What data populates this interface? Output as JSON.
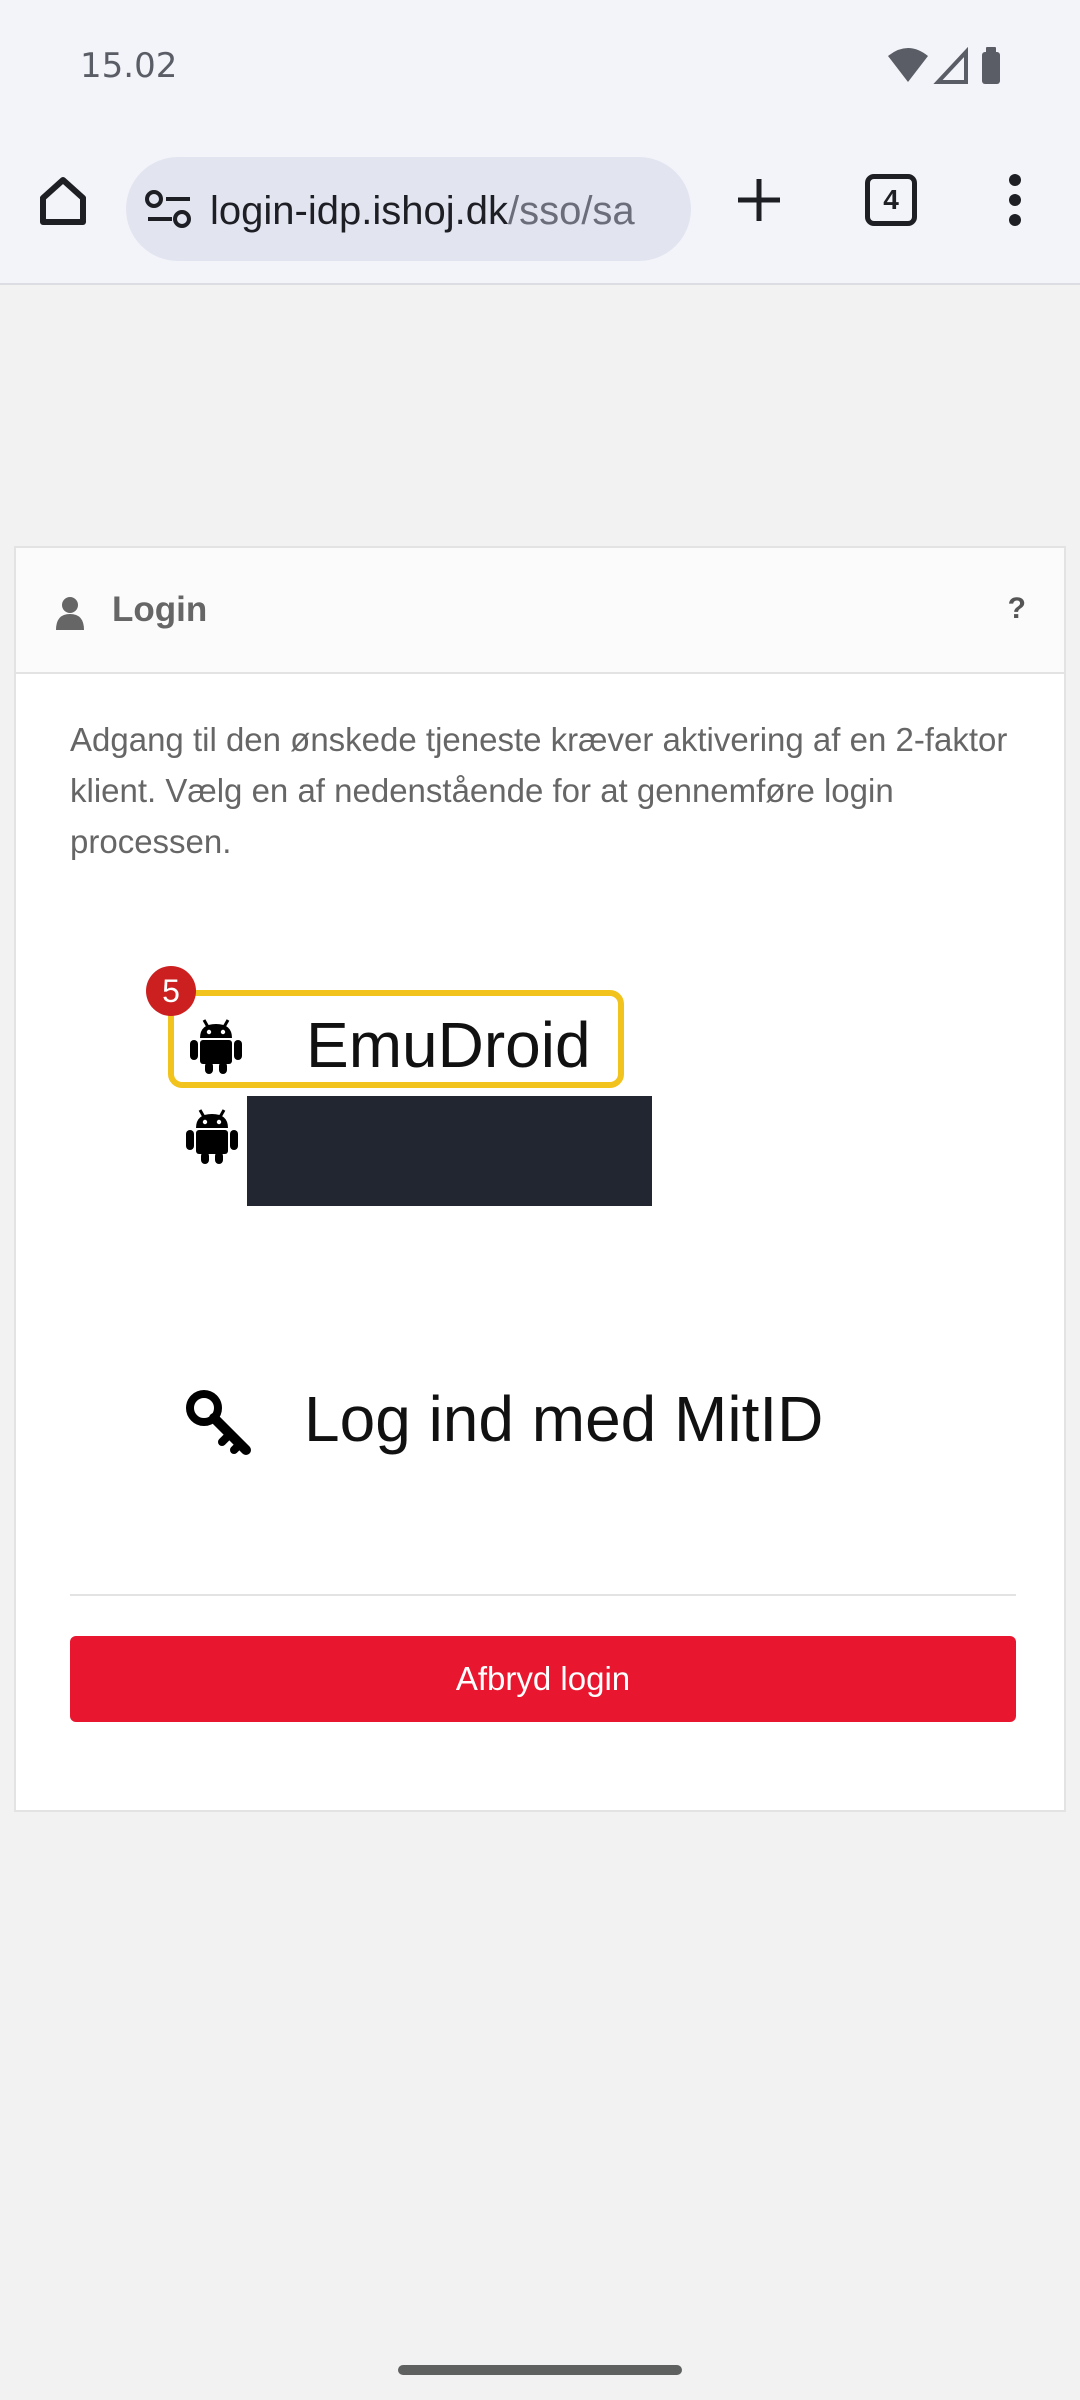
{
  "status_bar": {
    "time": "15.02"
  },
  "browser": {
    "url_domain": "login-idp.ishoj.dk",
    "url_path": "/sso/sa",
    "tab_count": "4"
  },
  "card": {
    "title": "Login",
    "help": "?",
    "description": "Adgang til den ønskede tjeneste kræver aktivering af en 2-faktor klient. Vælg en af nedenstående for at gennemføre login processen.",
    "options": [
      {
        "label": "EmuDroid",
        "badge": "5"
      }
    ],
    "mitid_label": "Log ind med MitID",
    "abort_label": "Afbryd login"
  },
  "colors": {
    "abort_button": "#e8172f",
    "highlight_border": "#f2c21d",
    "badge": "#cc2020"
  }
}
